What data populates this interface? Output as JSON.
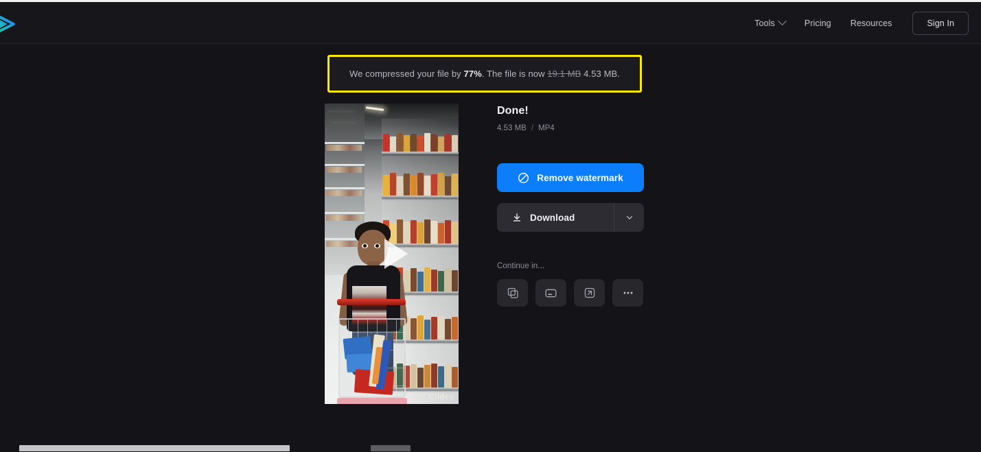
{
  "header": {
    "logo_name": "play-logo",
    "nav": [
      {
        "label": "Tools",
        "has_dropdown": true
      },
      {
        "label": "Pricing",
        "has_dropdown": false
      },
      {
        "label": "Resources",
        "has_dropdown": false
      }
    ],
    "sign_in_label": "Sign In"
  },
  "banner": {
    "prefix": "We compressed your file by ",
    "percent": "77%",
    "middle": ". The file is now ",
    "old_size": "19.1 MB",
    "new_size": " 4.53 MB.",
    "border_color": "#ffeb00",
    "background_color": "#1b1b20"
  },
  "preview": {
    "watermark": "Clideo",
    "play_icon": "play-triangle-icon"
  },
  "result": {
    "title": "Done!",
    "file_size": "4.53 MB",
    "separator": "/",
    "file_format": "MP4",
    "remove_watermark_label": "Remove watermark",
    "remove_watermark_icon": "prohibition-icon",
    "remove_watermark_color": "#0d7efb",
    "download_label": "Download",
    "download_icon": "download-icon",
    "download_dropdown_icon": "chevron-down-icon",
    "continue_label": "Continue in...",
    "continue_actions": [
      {
        "icon": "copy-icon",
        "name": "duplicate"
      },
      {
        "icon": "video-frame-icon",
        "name": "compress"
      },
      {
        "icon": "resize-icon",
        "name": "resize"
      },
      {
        "icon": "more-dots-icon",
        "name": "more"
      }
    ]
  }
}
